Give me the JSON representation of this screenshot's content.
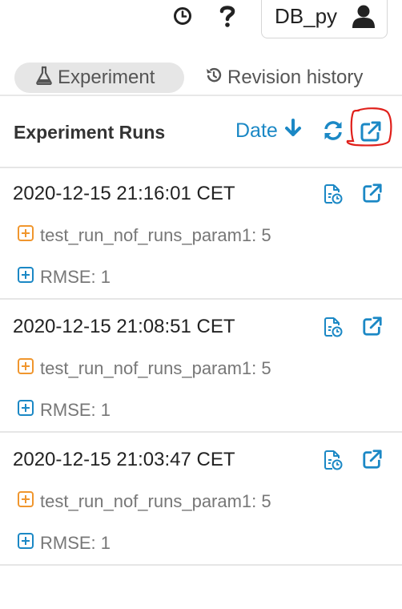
{
  "topbar": {
    "history_icon": "clock-history-icon",
    "help_icon": "question-icon",
    "user": {
      "label": "DB_py",
      "icon": "user-icon"
    }
  },
  "tabs": [
    {
      "label": "Experiment",
      "icon": "flask-icon",
      "active": true
    },
    {
      "label": "Revision history",
      "icon": "history-icon",
      "active": false
    }
  ],
  "runs_panel": {
    "title": "Experiment Runs",
    "sort_label": "Date",
    "sort_icon": "arrow-down-icon",
    "refresh_icon": "refresh-icon",
    "open_icon": "external-link-icon"
  },
  "runs": [
    {
      "timestamp": "2020-12-15 21:16:01 CET",
      "param": "test_run_nof_runs_param1: 5",
      "metric": "RMSE: 1"
    },
    {
      "timestamp": "2020-12-15 21:08:51 CET",
      "param": "test_run_nof_runs_param1: 5",
      "metric": "RMSE: 1"
    },
    {
      "timestamp": "2020-12-15 21:03:47 CET",
      "param": "test_run_nof_runs_param1: 5",
      "metric": "RMSE: 1"
    }
  ],
  "colors": {
    "accent": "#1b88c5",
    "param_icon": "#f0962e",
    "metric_icon": "#1b88c5",
    "annotation": "#e0201b"
  }
}
